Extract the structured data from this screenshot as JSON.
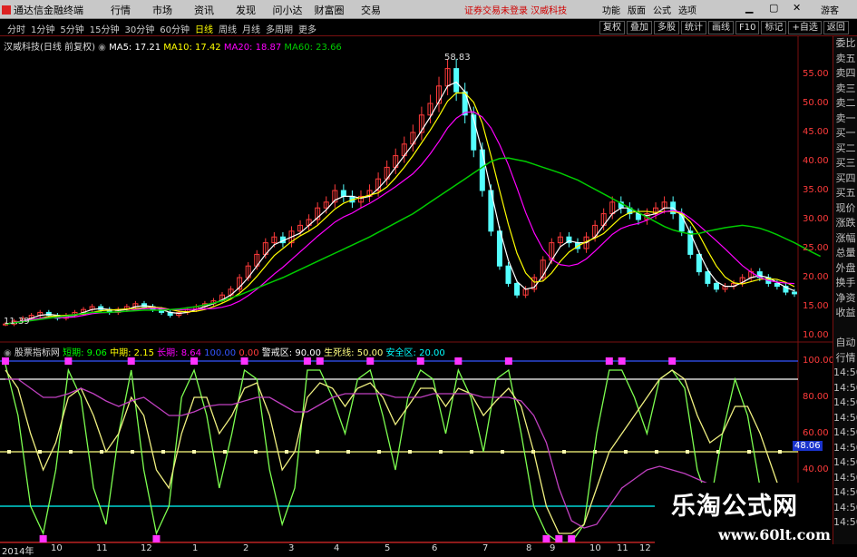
{
  "app": {
    "title": "通达信金融终端"
  },
  "menu": [
    "行情",
    "市场",
    "资讯",
    "发现",
    "问小达",
    "财富圈",
    "交易"
  ],
  "notice": "证券交易未登录  汉威科技",
  "right_menu": [
    "功能",
    "版面",
    "公式",
    "选项"
  ],
  "guest": "游客",
  "periods": [
    {
      "label": "分时",
      "active": false
    },
    {
      "label": "1分钟",
      "active": false
    },
    {
      "label": "5分钟",
      "active": false
    },
    {
      "label": "15分钟",
      "active": false
    },
    {
      "label": "30分钟",
      "active": false
    },
    {
      "label": "60分钟",
      "active": false
    },
    {
      "label": "日线",
      "active": true
    },
    {
      "label": "周线",
      "active": false
    },
    {
      "label": "月线",
      "active": false
    },
    {
      "label": "多周期",
      "active": false
    },
    {
      "label": "更多",
      "active": false
    }
  ],
  "tools": [
    "复权",
    "叠加",
    "多股",
    "统计",
    "画线",
    "F10",
    "标记",
    "+自选",
    "返回"
  ],
  "main_legend": {
    "name": "汉威科技(日线 前复权)",
    "ma5": "MA5: 17.21",
    "ma10": "MA10: 17.42",
    "ma20": "MA20: 18.87",
    "ma60": "MA60: 23.66"
  },
  "sub_legend": {
    "name": "股票指标网",
    "short": "短期: 9.06",
    "mid": "中期: 2.15",
    "long": "长期: 8.64",
    "v100": "100.00",
    "v0": "0.00",
    "alarm": "警戒区: 90.00",
    "life": "生死线: 50.00",
    "safe": "安全区: 20.00"
  },
  "colors": {
    "ma5": "#ffffff",
    "ma10": "#ffff00",
    "ma20": "#ff00ff",
    "ma60": "#00cc00",
    "up": "#ff3b3b",
    "down": "#54ffff",
    "axis": "#7a1010"
  },
  "annotations": {
    "high": "58.83",
    "low": "11.39",
    "badge": "48.06"
  },
  "price_axis": [
    "55.00",
    "50.00",
    "45.00",
    "40.00",
    "35.00",
    "30.00",
    "25.00",
    "20.00",
    "15.00",
    "10.00"
  ],
  "ind_axis": [
    "100.00",
    "80.00",
    "60.00",
    "40.00"
  ],
  "quote_panel": [
    "委比",
    "卖五",
    "卖四",
    "卖三",
    "卖二",
    "卖一",
    "买一",
    "买二",
    "买三",
    "买四",
    "买五",
    "现价",
    "涨跌",
    "涨幅",
    "总量",
    "外盘",
    "换手",
    "净资",
    "收益",
    "",
    "自动",
    "行情",
    "14:50",
    "14:50",
    "14:50",
    "14:50",
    "14:50",
    "14:50",
    "14:50",
    "14:50",
    "14:50",
    "14:50",
    "14:50"
  ],
  "dates": [
    "2014年",
    "10",
    "11",
    "12",
    "1",
    "2",
    "3",
    "4",
    "5",
    "6",
    "7",
    "8",
    "9",
    "10",
    "11",
    "12"
  ],
  "watermark": {
    "title": "乐淘公式网",
    "url": "www.60lt.com"
  },
  "chart_data": {
    "type": "line",
    "price_series": {
      "close": [
        12,
        12.5,
        13,
        13.5,
        14,
        13.5,
        13,
        13.5,
        14,
        14.5,
        15,
        14.5,
        14,
        14.5,
        15,
        15.5,
        15,
        14.5,
        14,
        13.5,
        14,
        14.5,
        15,
        15.5,
        16,
        17,
        18,
        20,
        22,
        24,
        26,
        27,
        26,
        28,
        29,
        30,
        32,
        33,
        35,
        34,
        33,
        34,
        35,
        37,
        39,
        41,
        43,
        45,
        48,
        50,
        53,
        56,
        52,
        48,
        42,
        35,
        28,
        22,
        19,
        17,
        18,
        20,
        23,
        26,
        27,
        26,
        25,
        27,
        29,
        31,
        33,
        32,
        31,
        30,
        31,
        32,
        33,
        31,
        28,
        24,
        21,
        19,
        18,
        18.5,
        19,
        20,
        21,
        20,
        19,
        18.5,
        17.5,
        17.2
      ],
      "ma60": [
        12,
        12.2,
        12.4,
        12.6,
        12.8,
        13,
        13.2,
        13.4,
        13.6,
        13.8,
        14,
        14,
        14,
        14.1,
        14.2,
        14.3,
        14.4,
        14.4,
        14.4,
        14.5,
        14.6,
        14.8,
        15,
        15.3,
        15.6,
        16,
        16.5,
        17,
        17.6,
        18.2,
        18.8,
        19.4,
        20,
        20.7,
        21.4,
        22.1,
        22.8,
        23.5,
        24.2,
        24.9,
        25.6,
        26.3,
        27,
        27.8,
        28.6,
        29.4,
        30.2,
        31,
        32,
        33,
        34,
        35,
        36,
        37,
        38,
        39,
        40,
        40.5,
        40.6,
        40.3,
        40,
        39.5,
        39,
        38.5,
        38,
        37.4,
        36.8,
        36,
        35.2,
        34.4,
        33.6,
        32.8,
        32,
        31.2,
        30.4,
        29.6,
        28.8,
        28.2,
        27.8,
        27.5,
        27.6,
        28,
        28.3,
        28.6,
        28.8,
        29,
        28.8,
        28.5,
        28,
        27.4,
        26.7,
        26,
        25.2,
        24.4,
        23.66
      ]
    },
    "indicator_series": [
      {
        "name": "短期",
        "values": [
          98,
          70,
          20,
          5,
          40,
          95,
          80,
          30,
          10,
          60,
          95,
          40,
          5,
          20,
          80,
          95,
          70,
          30,
          60,
          95,
          90,
          40,
          10,
          30,
          95,
          95,
          80,
          60,
          90,
          95,
          70,
          40,
          80,
          95,
          90,
          60,
          95,
          80,
          50,
          90,
          95,
          60,
          20,
          5,
          0,
          0,
          10,
          60,
          95,
          95,
          80,
          60,
          90,
          95,
          85,
          40,
          20,
          60,
          90,
          70,
          30,
          10,
          0
        ]
      },
      {
        "name": "中期",
        "values": [
          95,
          85,
          60,
          40,
          55,
          80,
          85,
          70,
          50,
          60,
          80,
          70,
          40,
          30,
          60,
          80,
          80,
          60,
          70,
          85,
          88,
          70,
          40,
          50,
          80,
          88,
          85,
          75,
          85,
          88,
          80,
          65,
          75,
          85,
          85,
          75,
          85,
          82,
          70,
          78,
          85,
          75,
          50,
          20,
          5,
          5,
          10,
          30,
          50,
          60,
          70,
          80,
          90,
          95,
          90,
          70,
          55,
          60,
          75,
          75,
          60,
          40,
          20
        ]
      },
      {
        "name": "长期",
        "values": [
          90,
          90,
          85,
          80,
          80,
          82,
          85,
          82,
          78,
          75,
          78,
          80,
          75,
          70,
          70,
          72,
          75,
          76,
          76,
          78,
          80,
          80,
          76,
          72,
          72,
          76,
          80,
          82,
          82,
          82,
          82,
          80,
          80,
          80,
          82,
          82,
          82,
          82,
          80,
          80,
          80,
          78,
          70,
          55,
          30,
          12,
          8,
          10,
          20,
          30,
          35,
          40,
          42,
          40,
          38,
          35,
          32,
          30,
          30,
          30,
          30,
          28,
          26
        ]
      }
    ],
    "levels": {
      "alarm": 90,
      "life": 50,
      "safe": 20
    },
    "price_ylim": [
      10,
      60
    ],
    "ind_ylim": [
      0,
      100
    ]
  }
}
